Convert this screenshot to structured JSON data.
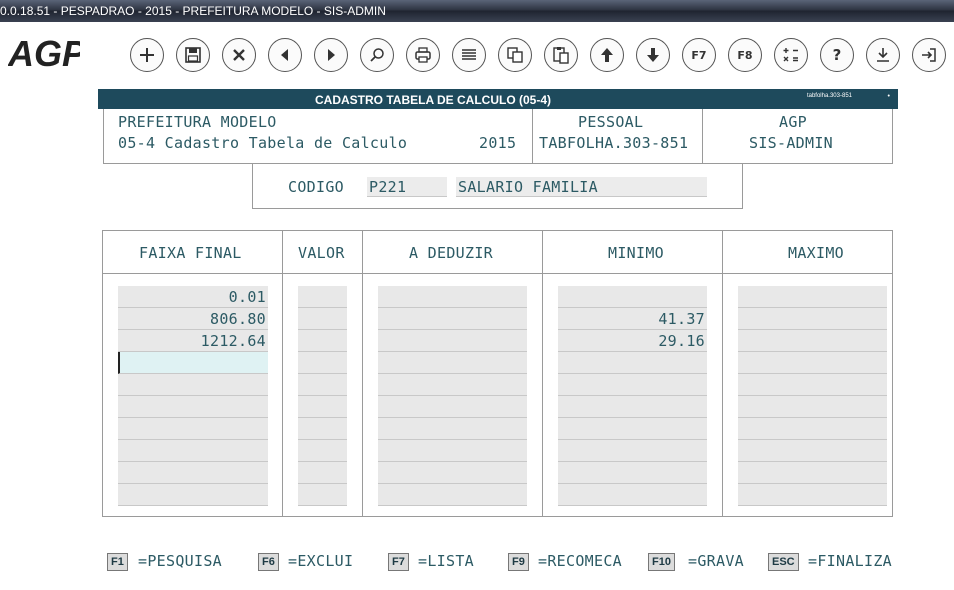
{
  "window": {
    "title": "0.0.18.51 - PESPADRAO - 2015 - PREFEITURA MODELO - SIS-ADMIN"
  },
  "logo": {
    "text": "AGP"
  },
  "toolbar": {
    "buttons": [
      {
        "name": "add-button",
        "icon": "plus-icon"
      },
      {
        "name": "save-button",
        "icon": "floppy-icon"
      },
      {
        "name": "cancel-button",
        "icon": "close-icon"
      },
      {
        "name": "previous-button",
        "icon": "triangle-left-icon"
      },
      {
        "name": "next-button",
        "icon": "triangle-right-icon"
      },
      {
        "name": "search-button",
        "icon": "magnifier-icon"
      },
      {
        "name": "print-button",
        "icon": "printer-icon"
      },
      {
        "name": "list-button",
        "icon": "list-icon"
      },
      {
        "name": "copy-button",
        "icon": "copy-icon"
      },
      {
        "name": "paste-button",
        "icon": "clipboard-icon"
      },
      {
        "name": "move-up-button",
        "icon": "arrow-up-icon"
      },
      {
        "name": "move-down-button",
        "icon": "arrow-down-icon"
      },
      {
        "name": "f7-button",
        "icon": "f7-icon",
        "label": "F7"
      },
      {
        "name": "f8-button",
        "icon": "f8-icon",
        "label": "F8"
      },
      {
        "name": "calculator-button",
        "icon": "calculator-icon"
      },
      {
        "name": "help-button",
        "icon": "question-icon",
        "label": "?"
      },
      {
        "name": "download-button",
        "icon": "download-icon"
      },
      {
        "name": "exit-button",
        "icon": "exit-icon"
      }
    ]
  },
  "form": {
    "title": "CADASTRO TABELA DE CALCULO (05-4)",
    "code": "tabfolha.303-851",
    "dot": "•"
  },
  "header": {
    "org": "PREFEITURA MODELO",
    "screen": "05-4 Cadastro Tabela de Calculo",
    "year": "2015",
    "module_label": "PESSOAL",
    "module_value": "TABFOLHA.303-851",
    "vendor_label": "AGP",
    "vendor_value": "SIS-ADMIN"
  },
  "codigo": {
    "label": "CODIGO",
    "code_value": "P221",
    "description_value": "SALARIO FAMILIA"
  },
  "table": {
    "columns": [
      "FAIXA FINAL",
      "VALOR",
      "A DEDUZIR",
      "MINIMO",
      "MAXIMO"
    ],
    "rows": [
      [
        "0.01",
        "",
        "",
        "",
        ""
      ],
      [
        "806.80",
        "",
        "",
        "41.37",
        ""
      ],
      [
        "1212.64",
        "",
        "",
        "29.16",
        ""
      ],
      [
        "",
        "",
        "",
        "",
        ""
      ],
      [
        "",
        "",
        "",
        "",
        ""
      ],
      [
        "",
        "",
        "",
        "",
        ""
      ],
      [
        "",
        "",
        "",
        "",
        ""
      ],
      [
        "",
        "",
        "",
        "",
        ""
      ],
      [
        "",
        "",
        "",
        "",
        ""
      ],
      [
        "",
        "",
        "",
        "",
        ""
      ]
    ]
  },
  "fkeys": [
    {
      "key": "F1",
      "desc": "=PESQUISA"
    },
    {
      "key": "F6",
      "desc": "=EXCLUI"
    },
    {
      "key": "F7",
      "desc": "=LISTA"
    },
    {
      "key": "F9",
      "desc": "=RECOMECA"
    },
    {
      "key": "F10",
      "desc": "=GRAVA"
    },
    {
      "key": "ESC",
      "desc": "=FINALIZA"
    }
  ],
  "colors": {
    "header_bar": "#1e4a5c",
    "text": "#2c5a64",
    "field": "#e8e8e8",
    "active_field": "#dff2f3"
  }
}
